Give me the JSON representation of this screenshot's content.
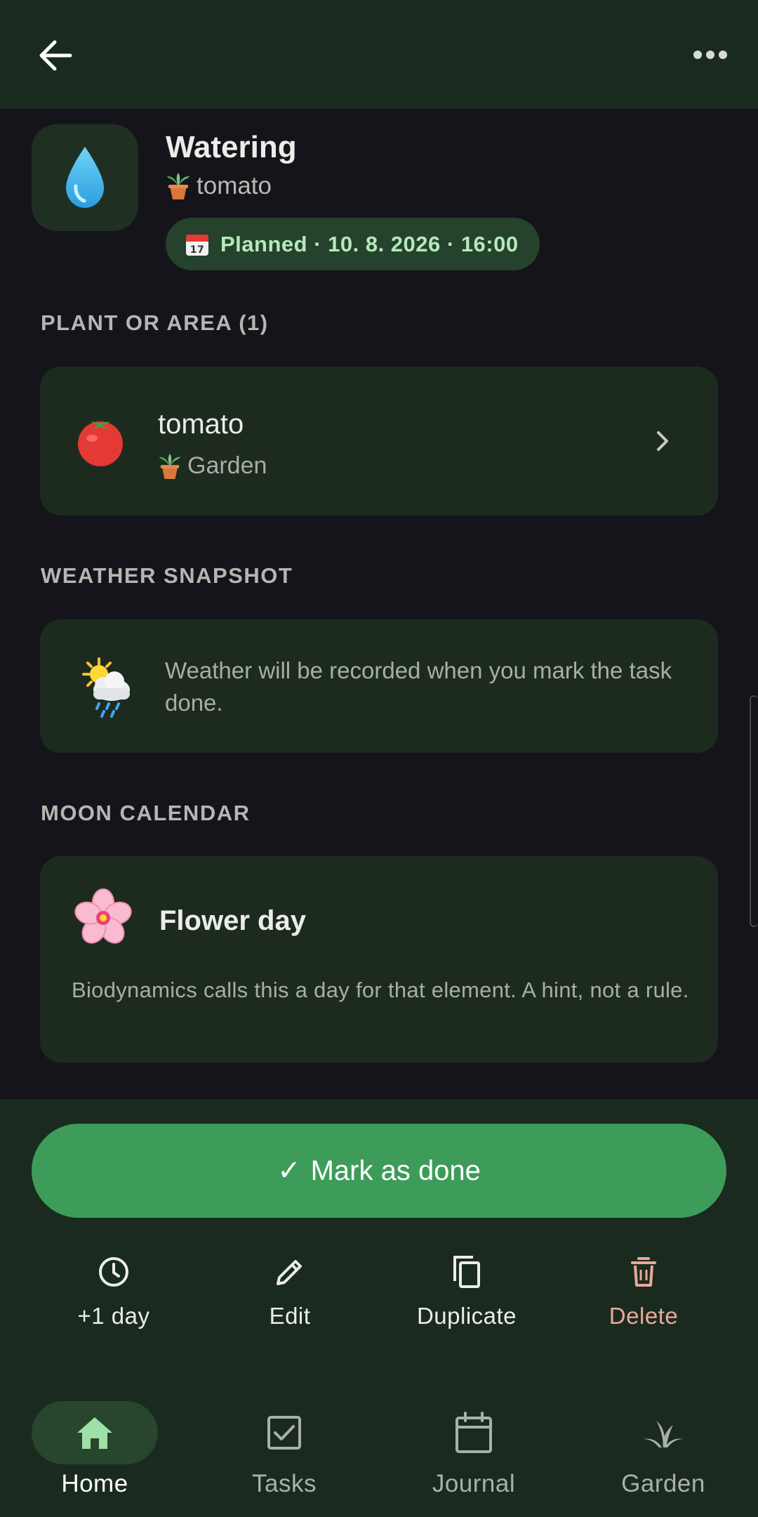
{
  "app_bar": {
    "back_icon": "arrow-left-icon",
    "more_icon": "more-horizontal-icon"
  },
  "task": {
    "icon": "droplet-icon",
    "title": "Watering",
    "plant_emoji": "potted-plant-icon",
    "plant": "tomato",
    "status_icon": "calendar-icon",
    "status": "Planned · 10. 8. 2026 · 16:00"
  },
  "plants_section": {
    "label": "PLANT OR AREA (1)",
    "items": [
      {
        "icon": "tomato-icon",
        "name": "tomato",
        "location_icon": "potted-plant-icon",
        "location": "Garden"
      }
    ]
  },
  "weather_section": {
    "label": "WEATHER SNAPSHOT",
    "icon": "sun-behind-rain-cloud-icon",
    "text": "Weather will be recorded when you mark the task done."
  },
  "moon_section": {
    "label": "MOON CALENDAR",
    "icon": "cherry-blossom-icon",
    "title": "Flower day",
    "text": "Biodynamics calls this a day for that element. A hint, not a rule."
  },
  "primary_action": {
    "check": "✓",
    "label": "Mark as done"
  },
  "actions": [
    {
      "icon": "clock-icon",
      "label": "+1 day"
    },
    {
      "icon": "pencil-icon",
      "label": "Edit"
    },
    {
      "icon": "copy-icon",
      "label": "Duplicate"
    },
    {
      "icon": "trash-icon",
      "label": "Delete"
    }
  ],
  "nav": [
    {
      "icon": "home-icon",
      "label": "Home",
      "active": true
    },
    {
      "icon": "checkbox-icon",
      "label": "Tasks",
      "active": false
    },
    {
      "icon": "calendar-icon",
      "label": "Journal",
      "active": false
    },
    {
      "icon": "sprout-icon",
      "label": "Garden",
      "active": false
    }
  ],
  "colors": {
    "background": "#15141b",
    "surface": "#1b2a1e",
    "card": "#1d2b1f",
    "accent": "#3d9c5a",
    "chip_bg": "#24422c",
    "chip_text": "#b6e8bc",
    "danger_text": "#e8a99c"
  }
}
